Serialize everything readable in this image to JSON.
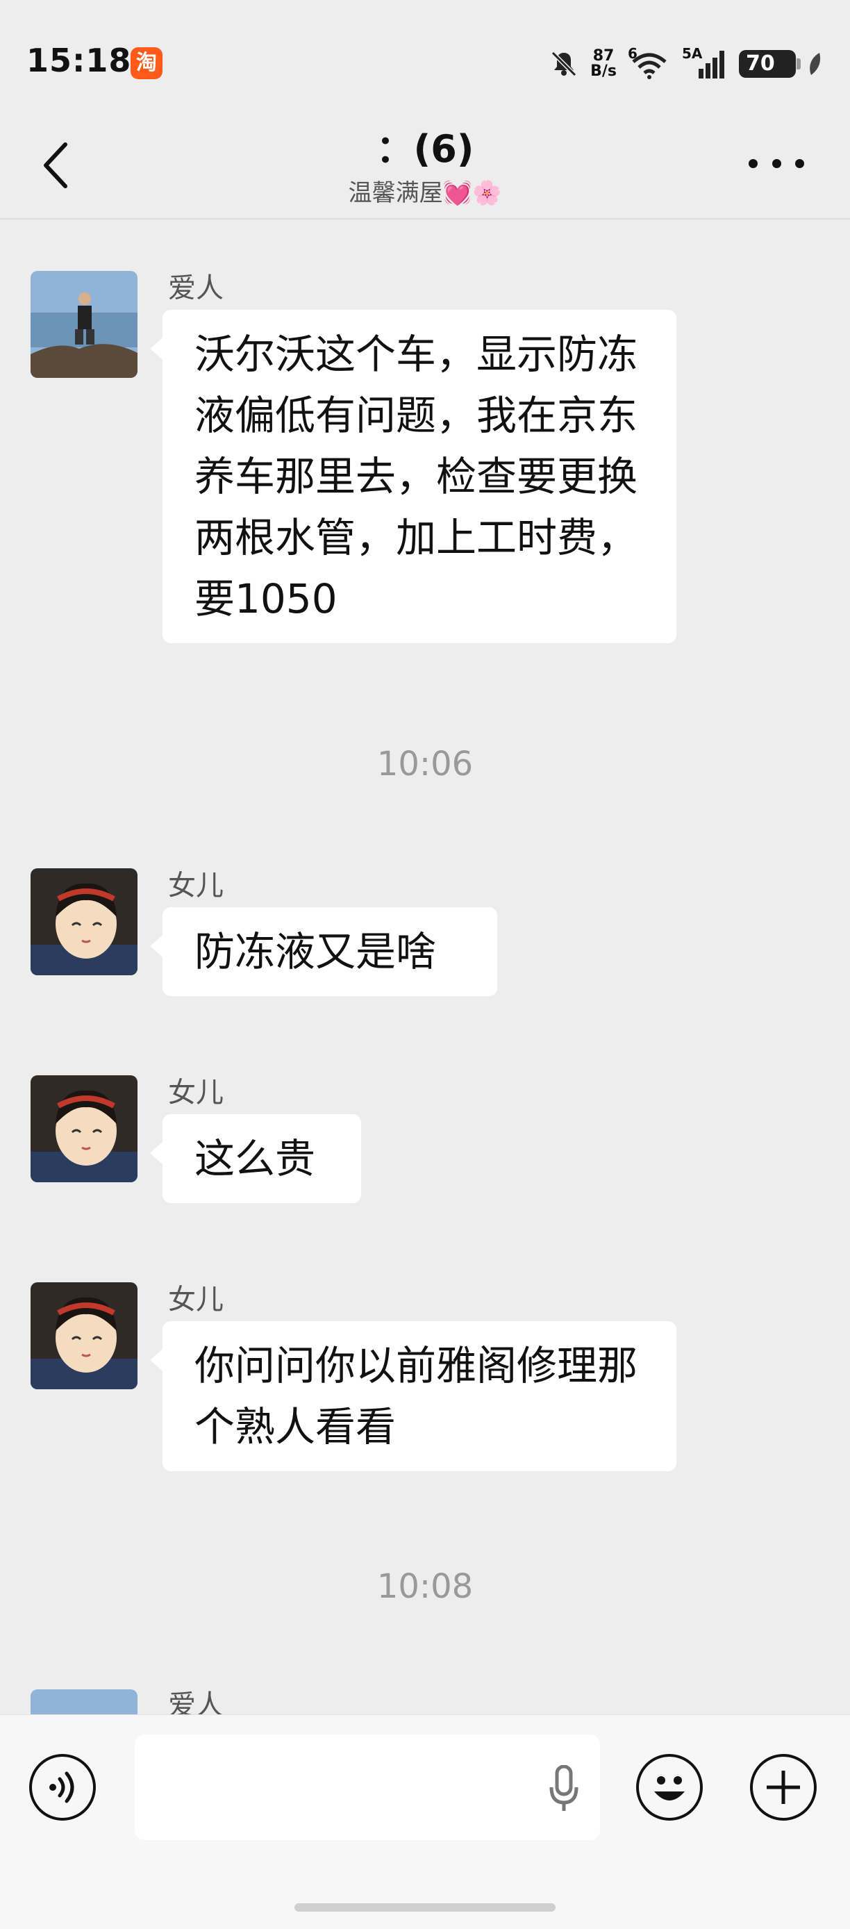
{
  "status_bar": {
    "time": "15:18",
    "app_badge": "淘",
    "net_speed_value": "87",
    "net_speed_unit": "B/s",
    "signal_label": "5A",
    "wifi_label": "6",
    "battery": "70"
  },
  "header": {
    "title": "：(6)",
    "subtitle": "温馨满屋💓🌸"
  },
  "messages": [
    {
      "sender": "爱人",
      "text": "沃尔沃这个车，显示防冻液偏低有问题，我在京东养车那里去，检查要更换两根水管，加上工时费，要1050"
    },
    {
      "sender": "女儿",
      "text": "防冻液又是啥"
    },
    {
      "sender": "女儿",
      "text": "这么贵"
    },
    {
      "sender": "女儿",
      "text": "你问问你以前雅阁修理那个熟人看看"
    },
    {
      "sender": "爱人",
      "text": ""
    }
  ],
  "timestamps": [
    "10:06",
    "10:08"
  ],
  "colors": {
    "background": "#ededed",
    "bubble": "#ffffff",
    "taobao_badge": "#ff5a1a"
  }
}
